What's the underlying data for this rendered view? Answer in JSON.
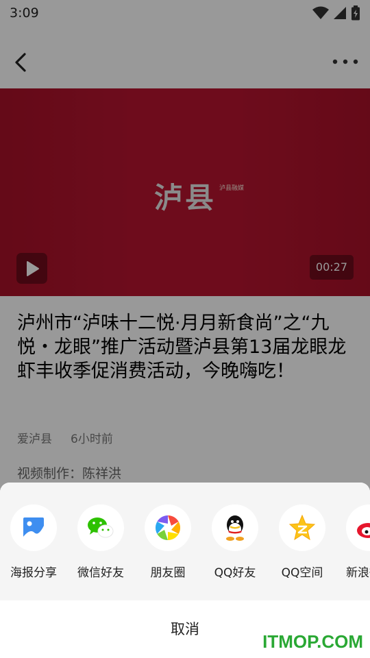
{
  "status_bar": {
    "time": "3:09"
  },
  "video": {
    "headline": "泸县",
    "logo_text": "泸县融媒",
    "duration": "00:27"
  },
  "article": {
    "title": "泸州市“泸味十二悦·月月新食尚”之“九悦・龙眼”推广活动暨泸县第13届龙眼龙虾丰收季促消费活动，今晚嗨吃！",
    "source": "爱泸县",
    "time_ago": "6小时前",
    "credit": "视频制作：陈祥洪"
  },
  "share_sheet": {
    "items": [
      {
        "label": "海报分享",
        "icon": "poster-icon"
      },
      {
        "label": "微信好友",
        "icon": "wechat-icon"
      },
      {
        "label": "朋友圈",
        "icon": "moments-icon"
      },
      {
        "label": "QQ好友",
        "icon": "qq-icon"
      },
      {
        "label": "QQ空间",
        "icon": "qzone-icon"
      },
      {
        "label": "新浪微博",
        "icon": "weibo-icon"
      }
    ],
    "cancel_label": "取消"
  },
  "watermark": "ITMOP.COM"
}
